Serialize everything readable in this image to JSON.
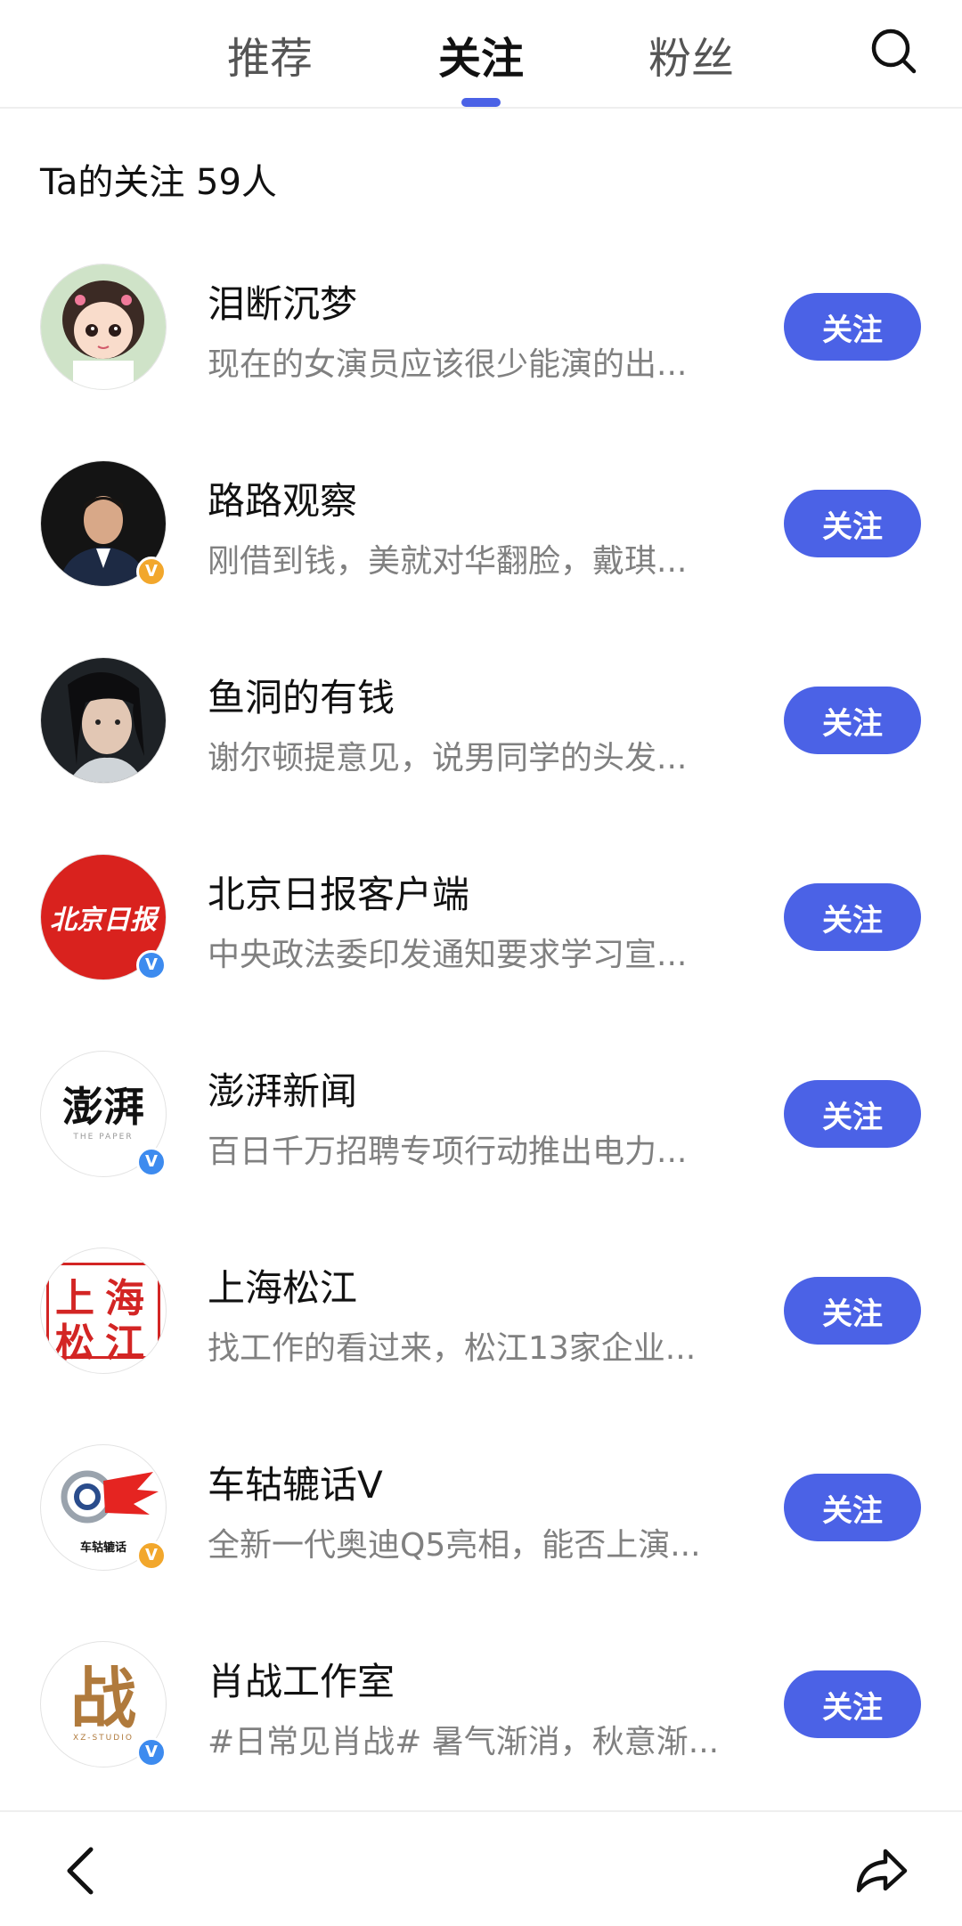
{
  "tabs": {
    "recommend": "推荐",
    "following": "关注",
    "fans": "粉丝"
  },
  "count_text": "Ta的关注 59人",
  "accent_color": "#4b62e6",
  "follow_label": "关注",
  "users": [
    {
      "name": "泪断沉梦",
      "desc": "现在的女演员应该很少能演的出...",
      "badge": "",
      "avatar": "cartoon-girl-avatar"
    },
    {
      "name": "路路观察",
      "desc": "刚借到钱，美就对华翻脸，戴琪...",
      "badge": "gold",
      "avatar": "man-portrait-avatar"
    },
    {
      "name": "鱼洞的有钱",
      "desc": "谢尔顿提意见，说男同学的头发...",
      "badge": "",
      "avatar": "costume-portrait-avatar"
    },
    {
      "name": "北京日报客户端",
      "desc": "中央政法委印发通知要求学习宣...",
      "badge": "blue",
      "avatar": "beijing-daily-logo",
      "logo_text": "北京日报"
    },
    {
      "name": "澎湃新闻",
      "desc": "百日千万招聘专项行动推出电力...",
      "badge": "blue",
      "avatar": "the-paper-logo",
      "logo_text": "澎湃",
      "logo_sub": "THE PAPER"
    },
    {
      "name": "上海松江",
      "desc": "找工作的看过来，松江13家企业...",
      "badge": "",
      "avatar": "shanghai-songjiang-logo",
      "logo_text": [
        "上",
        "海",
        "松",
        "江"
      ]
    },
    {
      "name": "车轱辘话V",
      "desc": "全新一代奥迪Q5亮相，能否上演...",
      "badge": "gold",
      "avatar": "chegulu-logo",
      "logo_text": "车轱辘话"
    },
    {
      "name": "肖战工作室",
      "desc": "#日常见肖战# 暑气渐消，秋意渐...",
      "badge": "blue",
      "avatar": "xz-studio-logo",
      "logo_text": "战",
      "logo_sub": "XZ-STUDIO"
    }
  ]
}
